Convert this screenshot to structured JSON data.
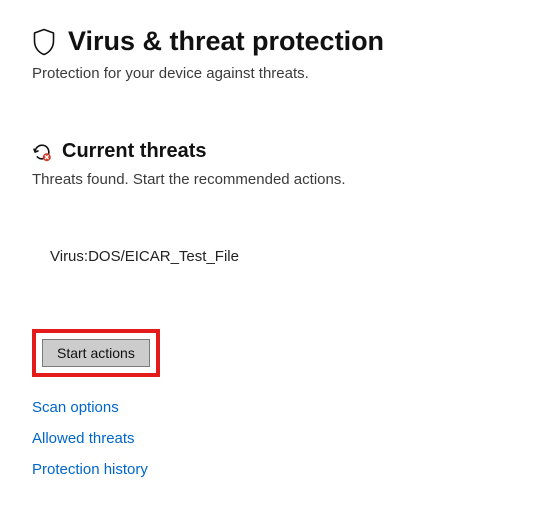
{
  "header": {
    "title": "Virus & threat protection",
    "subtitle": "Protection for your device against threats."
  },
  "currentThreats": {
    "title": "Current threats",
    "subtitle": "Threats found. Start the recommended actions.",
    "items": [
      {
        "name": "Virus:DOS/EICAR_Test_File"
      }
    ],
    "startActionsLabel": "Start actions"
  },
  "links": {
    "scanOptions": "Scan options",
    "allowedThreats": "Allowed threats",
    "protectionHistory": "Protection history"
  },
  "icons": {
    "shield": "shield-icon",
    "currentThreats": "threat-history-icon"
  }
}
